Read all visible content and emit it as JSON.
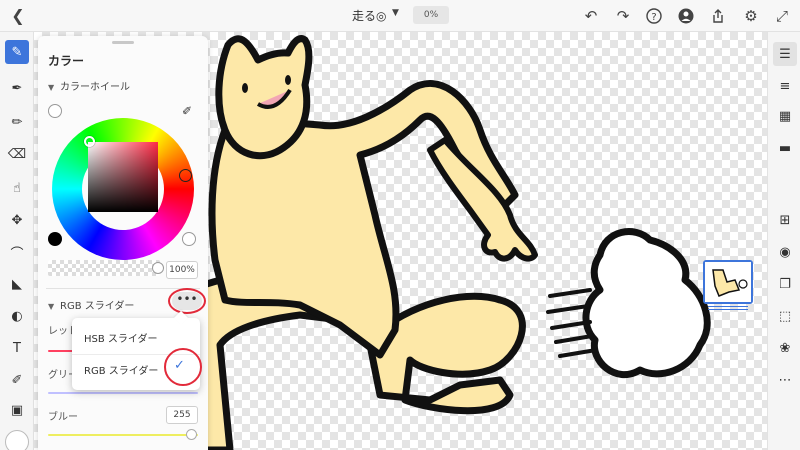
{
  "header": {
    "back_icon": "chevron-left-icon",
    "doc_title": "走る◎",
    "zoom": "0%",
    "icons": [
      "undo-icon",
      "redo-icon",
      "help-icon",
      "add-user-icon",
      "share-icon",
      "settings-icon",
      "collapse-icon"
    ]
  },
  "color_panel": {
    "title": "カラー",
    "wheel_section": "カラーホイール",
    "opacity_value": "100%",
    "rgb_section": "RGB スライダー",
    "sliders": [
      {
        "label": "レッド",
        "color": "#ff4060"
      },
      {
        "label": "グリーン",
        "color": "#c0c0ff"
      },
      {
        "label": "ブルー",
        "value": "255",
        "color": "#eeee60"
      }
    ],
    "menu": {
      "items": [
        "HSB スライダー",
        "RGB スライダー"
      ],
      "selected": "RGB スライダー"
    }
  },
  "colors": {
    "accent": "#3d75db",
    "annotation": "#e22a3a",
    "character_fill": "#fde8a8"
  }
}
